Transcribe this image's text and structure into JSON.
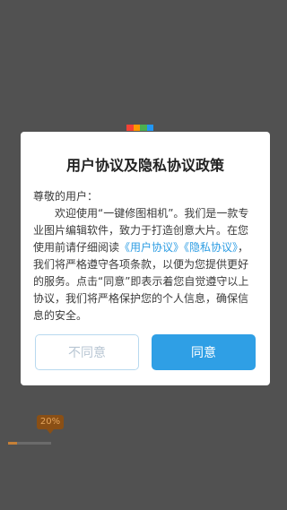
{
  "background": {
    "progress_percent": 20,
    "progress_label": "20%",
    "logo_colors": [
      "#f44336",
      "#ff9800",
      "#4caf50",
      "#2196f3"
    ]
  },
  "dialog": {
    "title": "用户协议及隐私协议政策",
    "greeting": "尊敬的用户：",
    "intro_text": "欢迎使用“一键修图相机”。我们是一款专业图片编辑软件，致力于打造创意大片。在您使用前请仔细阅读",
    "user_agreement_link": "《用户协议》",
    "privacy_policy_link": "《隐私协议》",
    "body_text": "，我们将严格遵守各项条款，以便为您提供更好的服务。点击“同意”即表示着您自觉遵守以上协议，我们将严格保护您的个人信息，确保信息的安全。",
    "cancel_button_label": "不同意",
    "accept_button_label": "同意"
  },
  "colors": {
    "accent": "#2f9fe5",
    "link": "#2d9de3",
    "cancel_text": "#b8c6d3",
    "overlay": "#515151"
  }
}
